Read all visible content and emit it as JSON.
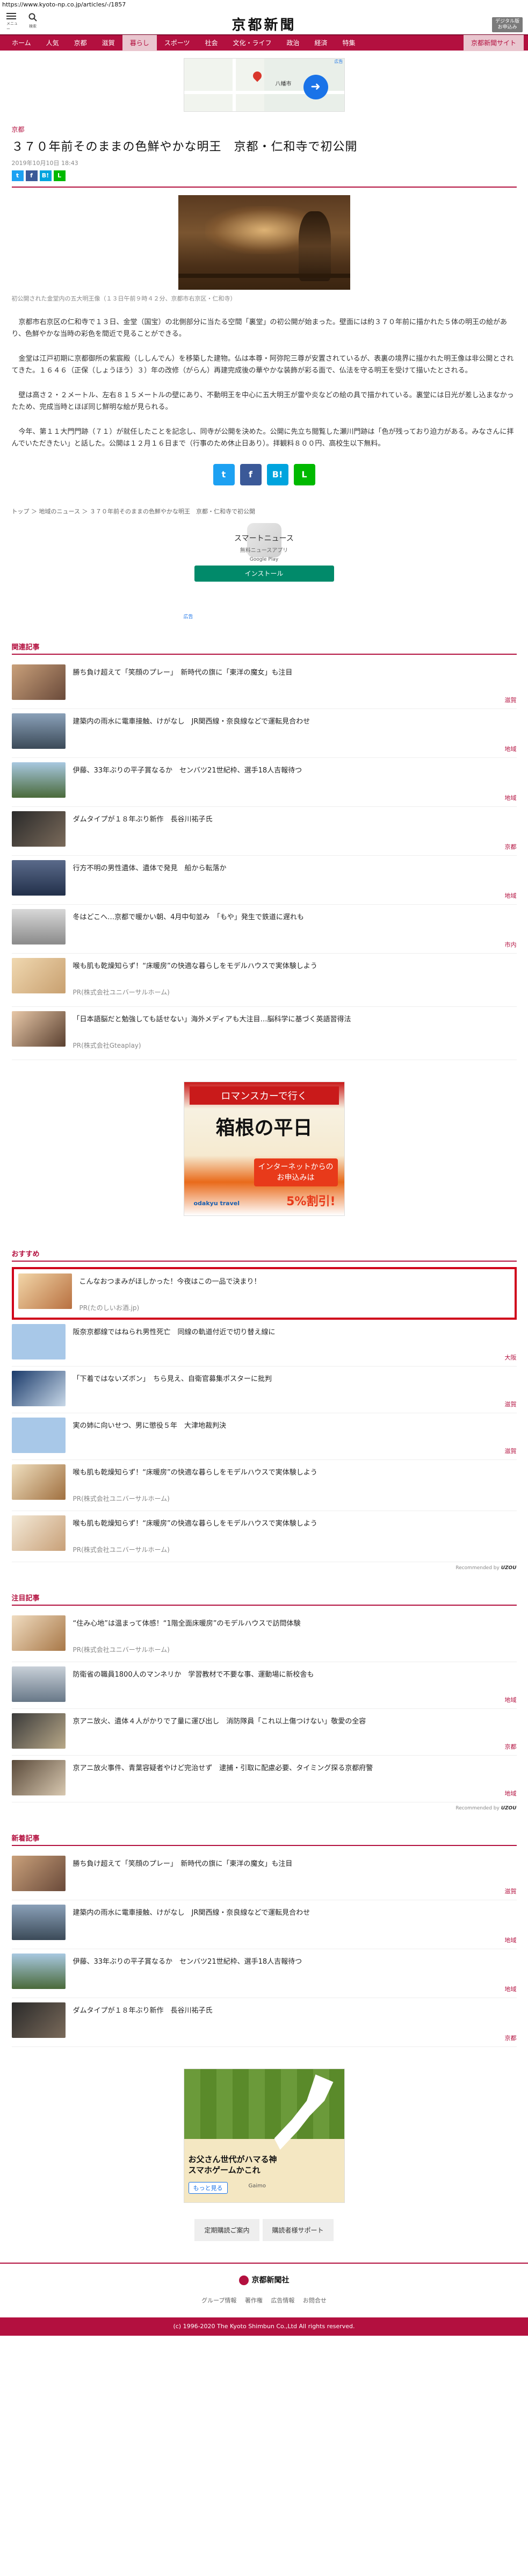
{
  "browser": {
    "url": "https://www.kyoto-np.co.jp/articles/-/1857"
  },
  "header": {
    "menu_label": "メニュー",
    "search_label": "検索",
    "logo": "京都新聞",
    "digital_label": "デジタル版\nお申込み"
  },
  "nav": {
    "items": [
      "ホーム",
      "人気",
      "京都",
      "滋賀",
      "暮らし",
      "スポーツ",
      "社会",
      "文化・ライフ",
      "政治",
      "経済",
      "特集"
    ],
    "active_index": 4,
    "extra": "京都新聞サイト"
  },
  "top_ad": {
    "place": "八幡市",
    "ad_mark": "広告"
  },
  "article": {
    "category": "京都",
    "title": "３７０年前そのままの色鮮やかな明王　京都・仁和寺で初公開",
    "date": "2019年10月10日 18:43",
    "photo_caption": "初公開された金堂内の五大明王像（１３日午前９時４２分、京都市右京区・仁和寺）",
    "paragraphs": [
      "京都市右京区の仁和寺で１３日、金堂（国宝）の北側部分に当たる空間「裏堂」の初公開が始まった。壁面には約３７０年前に描かれた５体の明王の絵があり、色鮮やかな当時の彩色を間近で見ることができる。",
      "金堂は江戸初期に京都御所の紫宸殿（ししんでん）を移築した建物。仏は本尊・阿弥陀三尊が安置されているが、表裏の境界に描かれた明王像は非公開とされてきた。１６４６（正保（しょうほう）３）年の改修（がらん）再建完成後の華やかな装飾が彩る面で、仏法を守る明王を受けて描いたとされる。",
      "壁は高さ２・２メートル、左右８１５メートルの壁にあり、不動明王を中心に五大明王が雷や炎などの絵の具で描かれている。裏堂には日光が差し込まなかったため、完成当時とほぼ同じ鮮明な絵が見られる。",
      "今年、第１１大門門跡（７１）が就任したことを記念し、同寺が公開を決めた。公開に先立ち閲覧した瀬川門跡は「色が残っており迫力がある。みなさんに拝んでいただきたい」と話した。公開は１２月１６日まで（行事のため休止日あり）。拝観料８００円、高校生以下無料。"
    ],
    "breadcrumb": [
      "トップ",
      "地域のニュース",
      "３７０年前そのままの色鮮やかな明王　京都・仁和寺で初公開"
    ]
  },
  "share": {
    "twitter": "Twitter",
    "facebook": "f",
    "hatena": "B!",
    "line": "LINE"
  },
  "app_ad": {
    "name": "スマートニュース",
    "sub": "無料ニュースアプリ",
    "store": "Google Play",
    "install": "インストール",
    "ad_label": "広告"
  },
  "related": {
    "title": "関連記事",
    "items": [
      {
        "text": "勝ち負け超えて「笑顔のプレー」　新時代の旗に「東洋の魔女」も注目",
        "tag": "滋賀"
      },
      {
        "text": "建築内の雨水に電車接触、けがなし　JR関西線・奈良線などで運転見合わせ",
        "tag": "地域"
      },
      {
        "text": "伊藤、33年ぶりの平子賞なるか　センバツ21世紀枠、選手18人吉報待つ",
        "tag": "地域"
      },
      {
        "text": "ダムタイプが１８年ぶり新作　長谷川祐子氏",
        "tag": "京都"
      },
      {
        "text": "行方不明の男性遺体、遺体で発見　船から転落か",
        "tag": "地域"
      },
      {
        "text": "冬はどこへ…京都で暖かい朝、4月中旬並み　「もや」発生で鉄道に遅れも",
        "tag": "市内"
      },
      {
        "text": "喉も肌も乾燥知らず！“床暖房”の快適な暮らしをモデルハウスで実体験しよう",
        "pr": "PR(株式会社ユニバーサルホーム)"
      },
      {
        "text": "「日本語脳だと勉強しても話せない」海外メディアも大注目…脳科学に基づく英語習得法",
        "pr": "PR(株式会社Gteaplay)"
      }
    ]
  },
  "big_ad": {
    "romance": "ロマンスカーで行く",
    "hakone": "箱根の平日",
    "promo": "インターネットからの\nお申込みは",
    "discount": "5%割引!",
    "brand": "odakyu travel"
  },
  "recommend": {
    "title": "おすすめ",
    "items": [
      {
        "text": "こんなおつまみがほしかった！今夜はこの一品で決まり！",
        "pr": "PR(たのしいお酒.jp)",
        "highlight": true
      },
      {
        "text": "阪奈京都線ではねられ男性死亡　同線の軌道付近で切り替え線に",
        "tag": "大阪"
      },
      {
        "text": "「下着ではないズボン」　ちら見え、自衛官募集ポスターに批判",
        "tag": "滋賀"
      },
      {
        "text": "実の姉に向いせつ、男に懲役５年　大津地裁判決",
        "tag": "滋賀"
      },
      {
        "text": "喉も肌も乾燥知らず！“床暖房”の快適な暮らしをモデルハウスで実体験しよう",
        "pr": "PR(株式会社ユニバーサルホーム)"
      },
      {
        "text": "喉も肌も乾燥知らず！“床暖房”の快適な暮らしをモデルハウスで実体験しよう",
        "pr": "PR(株式会社ユニバーサルホーム)"
      }
    ],
    "attribution_prefix": "Recommended by",
    "attribution_brand": "UZOU"
  },
  "notable": {
    "title": "注目記事",
    "items": [
      {
        "text": "“住み心地”は温まって体感！“1階全面床暖房”のモデルハウスで訪問体験",
        "pr": "PR(株式会社ユニバーサルホーム)"
      },
      {
        "text": "防衛省の職員1800人のマンネリか　学習教材で不要な事、運動場に新校舎も",
        "tag": "地域"
      },
      {
        "text": "京アニ放火、遺体４人がかりで了量に運び出し　消防隊員「これ以上傷つけない」敬愛の全容",
        "tag": "京都"
      },
      {
        "text": "京アニ放火事件、青葉容疑者やけど完治せず　逮捕・引取に配慮必要、タイミング探る京都府警",
        "tag": "地域"
      }
    ],
    "attribution_prefix": "Recommended by",
    "attribution_brand": "UZOU"
  },
  "latest": {
    "title": "新着記事",
    "items": [
      {
        "text": "勝ち負け超えて「笑顔のプレー」　新時代の旗に「東洋の魔女」も注目",
        "tag": "滋賀"
      },
      {
        "text": "建築内の雨水に電車接触、けがなし　JR関西線・奈良線などで運転見合わせ",
        "tag": "地域"
      },
      {
        "text": "伊藤、33年ぶりの平子賞なるか　センバツ21世紀枠、選手18人吉報待つ",
        "tag": "地域"
      },
      {
        "text": "ダムタイプが１８年ぶり新作　長谷川祐子氏",
        "tag": "京都"
      }
    ]
  },
  "bottom_ad": {
    "copy": "お父さん世代がハマる神スマホゲームかこれ",
    "more": "もっと見る",
    "brand": "Gaimo"
  },
  "footer": {
    "buttons": [
      "定期購読ご案内",
      "購読者様サポート"
    ],
    "logo": "京都新聞社",
    "links": [
      "グループ情報",
      "著作権",
      "広告情報",
      "お問合せ"
    ],
    "copyright": "(c) 1996-2020 The Kyoto Shimbun Co.,Ltd All rights reserved."
  },
  "colors": {
    "brand": "#b3103f",
    "highlight": "#d0021b"
  }
}
